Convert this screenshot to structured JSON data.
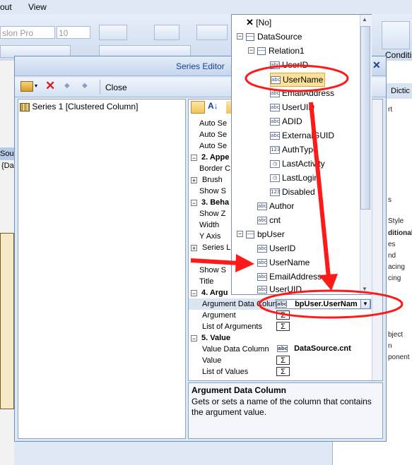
{
  "menu": {
    "item1": "out",
    "item2": "View"
  },
  "ribbon": {
    "font_name": "slon Pro",
    "font_size": "10",
    "right_label": "Conditi"
  },
  "right_panel": {
    "tab": "Dictic",
    "rows": [
      "rt",
      "s",
      "Style",
      "ditional",
      "es",
      "nd",
      "acing",
      "cing",
      "bject",
      "n",
      "ponent"
    ]
  },
  "left_bg": {
    "source_label": "Sou",
    "data_label": "{Da"
  },
  "dialog": {
    "title": "Series Editor",
    "close_glyph": "✕",
    "toolbar_close": "Close",
    "series_item": "Series 1 [Clustered Column]",
    "accent_color": "#ff0000"
  },
  "properties": {
    "rows": [
      {
        "kind": "prop",
        "label": "Auto Se",
        "top": 0
      },
      {
        "kind": "prop",
        "label": "Auto Se",
        "top": 0
      },
      {
        "kind": "prop",
        "label": "Auto Se",
        "top": 0
      }
    ],
    "cat_appearance": "2. Appe",
    "border": "Border C",
    "brush": "Brush",
    "show_s1": "Show S",
    "cat_behavior": "3. Beha",
    "show_z": "Show Z",
    "width": "Width",
    "y_axis": "Y Axis",
    "series_l": "Series L",
    "show_s2": "Show S",
    "title": "Title",
    "cat_argument": "4. Argu",
    "arg_data_col_label": "Argument Data Colum",
    "arg_data_col_value": "bpUser.UserNam",
    "argument": "Argument",
    "list_args": "List of Arguments",
    "cat_value": "5. Value",
    "value_data_col_label": "Value Data Column",
    "value_data_col_value": "DataSource.cnt",
    "value": "Value",
    "list_values": "List of Values",
    "sigma": "Σ"
  },
  "description": {
    "title": "Argument Data Column",
    "text": "Gets or sets a name of the column that contains the argument value."
  },
  "popup": {
    "none_label": "[No]",
    "datasource": "DataSource",
    "relation": "Relation1",
    "relation_fields": [
      "UserID",
      "UserName",
      "EmailAddress",
      "UserUID",
      "ADID",
      "ExternalGUID",
      "AuthType",
      "LastActivity",
      "LastLogin",
      "Disabled"
    ],
    "datasource_fields": [
      "Author",
      "cnt"
    ],
    "bpuser": "bpUser",
    "bpuser_fields": [
      "UserID",
      "UserName",
      "EmailAddress",
      "UserUID"
    ],
    "icon_abc": "abc",
    "icon_num": "123"
  }
}
